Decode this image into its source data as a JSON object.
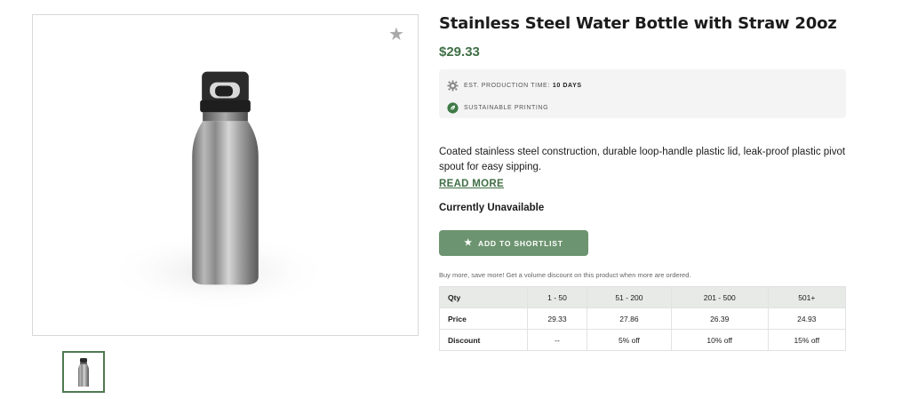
{
  "product": {
    "title": "Stainless Steel Water Bottle with Straw 20oz",
    "price": "$29.33",
    "favorite_icon": "star-icon",
    "thumbnail_count": 1
  },
  "meta": {
    "production_label": "EST. PRODUCTION TIME:",
    "production_value": "10 DAYS",
    "production_icon": "gear-icon",
    "sustainable_label": "SUSTAINABLE PRINTING",
    "sustainable_icon": "leaf-icon"
  },
  "description": {
    "text": "Coated stainless steel construction, durable loop-handle plastic lid, leak-proof plastic pivot spout for easy sipping.",
    "read_more": "READ MORE"
  },
  "availability": "Currently Unavailable",
  "shortlist_button": {
    "label": "ADD TO SHORTLIST",
    "icon": "star-icon"
  },
  "volume": {
    "note": "Buy more, save more! Get a volume discount on this product when more are ordered.",
    "header": [
      "Qty",
      "1 - 50",
      "51 - 200",
      "201 - 500",
      "501+"
    ],
    "price_row": [
      "Price",
      "29.33",
      "27.86",
      "26.39",
      "24.93"
    ],
    "discount_row": [
      "Discount",
      "--",
      "5% off",
      "10% off",
      "15% off"
    ]
  },
  "colors": {
    "brand_green": "#3f6f45",
    "button_green": "#6d9470",
    "table_header": "#e7eae7"
  }
}
